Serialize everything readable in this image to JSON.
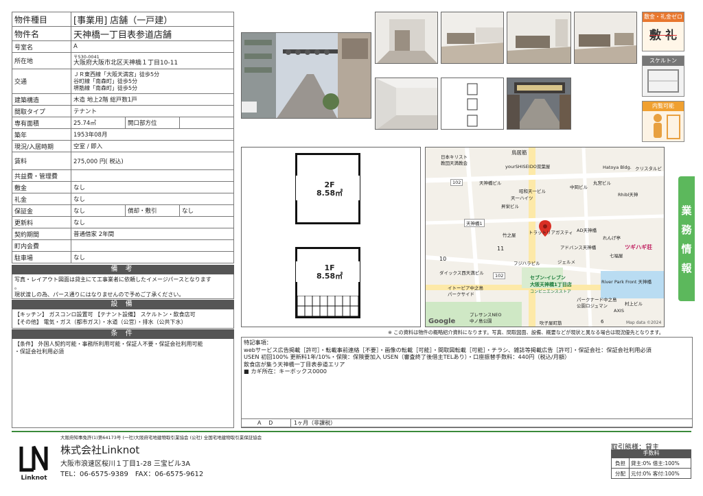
{
  "spec": {
    "type_label": "物件種目",
    "type_value": "[事業用] 店舗（一戸建）",
    "name_label": "物件名",
    "name_value": "天神橋一丁目表参道店舗",
    "room_label": "号室名",
    "room_value": "A",
    "address_label": "所在地",
    "postal": "〒530-0041",
    "address": "大阪府大阪市北区天神橋１丁目10-11",
    "transport_label": "交通",
    "transport": [
      "ＪＲ東西線「大阪天満宮」徒歩5分",
      "谷町線「南森町」徒歩5分",
      "堺筋線「南森町」徒歩5分"
    ],
    "structure_label": "建築構造",
    "structure_value": "木造 地上2階 総戸数1戸",
    "layout_label": "間取タイプ",
    "layout_value": "テナント",
    "area_label": "専有面積",
    "area_value": "25.74㎡",
    "opening_label": "開口部方位",
    "opening_value": "",
    "built_label": "築年",
    "built_value": "1953年08月",
    "status_label": "現況/入居時期",
    "status_value": "空室 / 即入",
    "rent_label": "賃料",
    "rent_value": "275,000 円( 税込)",
    "common_label": "共益費・管理費",
    "common_value": "",
    "deposit_label": "敷金",
    "deposit_value": "なし",
    "key_label": "礼金",
    "key_value": "なし",
    "guarantee_label": "保証金",
    "guarantee_value": "なし",
    "amort_label": "償却・敷引",
    "amort_value": "なし",
    "renewal_label": "更新料",
    "renewal_value": "なし",
    "contract_label": "契約期間",
    "contract_value": "普通借家 2年間",
    "council_label": "町内会費",
    "council_value": "",
    "parking_label": "駐車場",
    "parking_value": "なし"
  },
  "remarks": {
    "title": "備 考",
    "lines": [
      "写真・レイアウト図面は貸主にて工事業者に依頼したイメージパースとなります",
      "。",
      "現状渡しの為、パース通りにはなりませんので予めご了承ください。"
    ]
  },
  "equipment": {
    "title": "設 備",
    "lines": [
      "【キッチン】 ガスコンロ設置可 【テナント設備】 スケルトン・飲食店可",
      "【その他】 電気・ガス（都市ガス）・水道（公営）・排水（公共下水）"
    ]
  },
  "conditions": {
    "title": "条 件",
    "lines": [
      "【条件】 外国人契約可能・事務所利用可能・保証人不要・保証会社利用可能",
      "・保証会社利用必須"
    ]
  },
  "badges": {
    "zero_title": "敷金・礼金ゼロ",
    "zero_text": "敷 礼",
    "skeleton": "スケルトン",
    "viewing": "内覧可能"
  },
  "floorplan": {
    "f2": "2F",
    "f2_area": "8.58㎡",
    "f1": "1F",
    "f1_area": "8.58㎡"
  },
  "map": {
    "labels": [
      "鳥居筋",
      "日本キリスト",
      "教団天満教会",
      "yourSHISEIDO双葉屋",
      "Hatoya Bldg.",
      "クリスタルビ",
      "102",
      "天神橋ビル",
      "昭和天一ビル",
      "天一ハイツ",
      "中岡ビル",
      "丸宮ビル",
      "Rhibl天神",
      "昇栄ビル",
      "天神橋1",
      "竹之屋",
      "トラットリアガスティ",
      "AD天神橋",
      "れんげ亭",
      "11",
      "アドバンス天神橋",
      "ツギハギ荘",
      "10",
      "フジハラビル",
      "ジェルメ",
      "七福屋",
      "ダイックス西天満ビル",
      "102",
      "セブン-イレブン",
      "大阪天神橋1丁目店",
      "コンビニエンスストア",
      "River Park Front 天神橋",
      "イトーピア中之島",
      "パークサイド",
      "パークナード中之島",
      "公園ロジュマン",
      "村上ビル",
      "プレサンスNEO",
      "中ノ島公園",
      "吹子屋町筋",
      "AXIS",
      "6"
    ],
    "google": "Google",
    "mapdata": "Map data ©2024"
  },
  "disclaimer": "※ この資料は物件の概略紹介資料になります。写真、間取図面、設備、概要などが現状と異なる場合は現況優先となります。",
  "notes": {
    "lines": [
      "特記事項：",
      "webサービス広告掲載［許可］・転載事前連絡［不要］・画像の転載［可能］・間取図転載［可能］・チラシ、雑誌等掲載広告［許可］・保証会社：保証会社利用必須",
      "USEN 初回100% 更新料1年/10%・保険：保険要加入 USEN（審査終了後借主TELあり）・口座振替手数料：440円（税込/月額）",
      "飲食店が集う天神橋一丁目表参道エリア",
      "■ カギ所在：キーボックス0000"
    ],
    "ad_label": "Ａ Ｄ",
    "ad_value": "1ヶ月（非課税）"
  },
  "side_tab": "業務情報",
  "footer": {
    "license": "大阪府知事免許(1)第64173号 (一社)大阪府宅地建物取引業協会 (公社) 全国宅地建物取引業保証協会",
    "logo_text": "Linknot",
    "company": "株式会社Linknot",
    "address": "大阪市浪速区桜川１丁目1-28 三宝ビル3A",
    "tel": "TEL：06-6575-9389　FAX：06-6575-9612",
    "mode": "取引態様：貸主",
    "fee_header": "手数料",
    "burden_label": "負担",
    "burden_value": "貸主:0% 借主:100%",
    "share_label": "分配",
    "share_value": "元付:0% 客付:100%"
  },
  "colors": {
    "accent": "#3a8a3a",
    "tab": "#5cb85c",
    "header": "#555555",
    "pin": "#d93025"
  }
}
